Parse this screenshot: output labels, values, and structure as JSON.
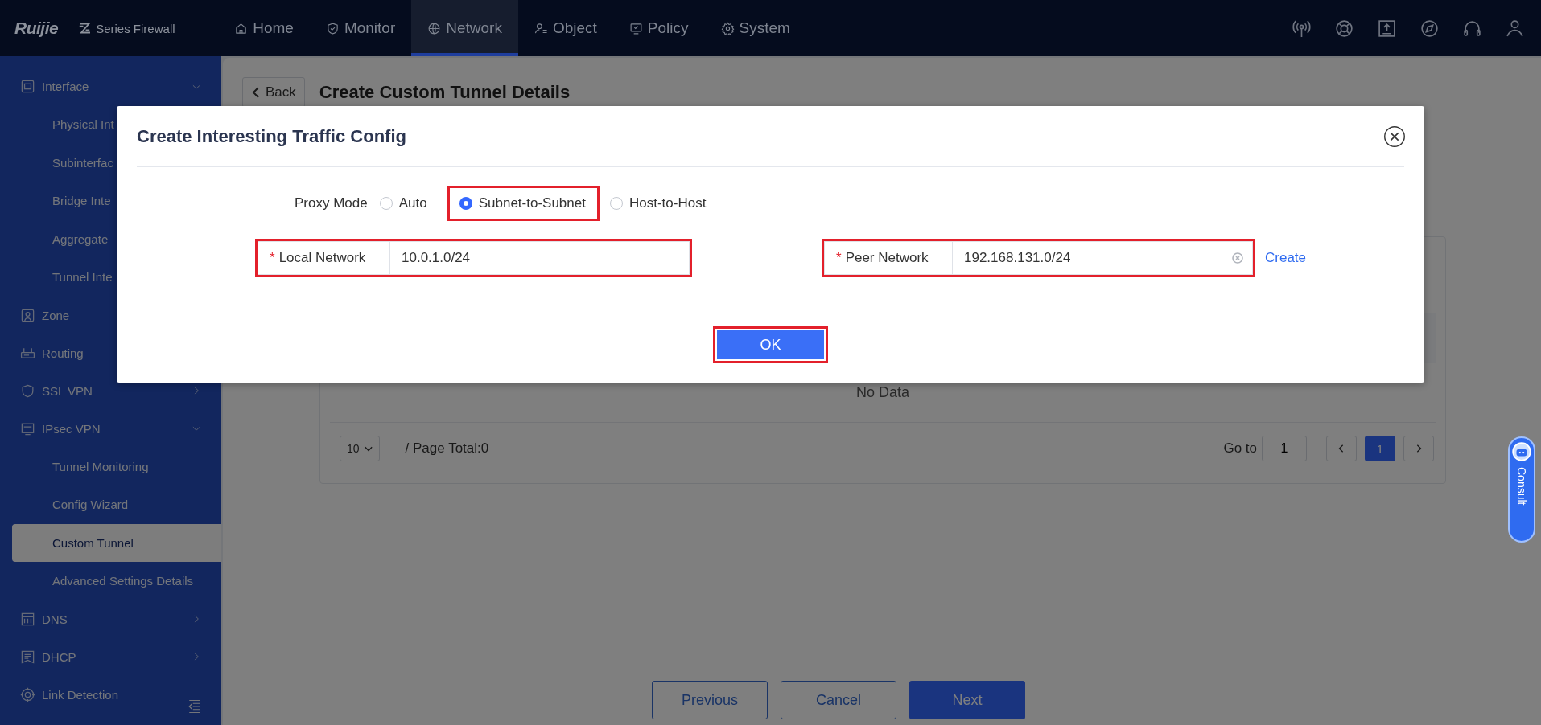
{
  "top_bar": {
    "logo": "Ruijie",
    "product": "Series Firewall",
    "nav": [
      {
        "label": "Home",
        "selected": false
      },
      {
        "label": "Monitor",
        "selected": false
      },
      {
        "label": "Network",
        "selected": true
      },
      {
        "label": "Object",
        "selected": false
      },
      {
        "label": "Policy",
        "selected": false
      },
      {
        "label": "System",
        "selected": false
      }
    ]
  },
  "sidebar": {
    "items": [
      {
        "label": "Interface",
        "expanded": true,
        "children": [
          {
            "label": "Physical Int",
            "selected": false
          },
          {
            "label": "Subinterfac",
            "selected": false
          },
          {
            "label": "Bridge Inte",
            "selected": false
          },
          {
            "label": "Aggregate",
            "selected": false
          },
          {
            "label": "Tunnel Inte",
            "selected": false
          }
        ]
      },
      {
        "label": "Zone"
      },
      {
        "label": "Routing"
      },
      {
        "label": "SSL VPN",
        "expanded": false
      },
      {
        "label": "IPsec VPN",
        "expanded": true,
        "children": [
          {
            "label": "Tunnel Monitoring",
            "selected": false
          },
          {
            "label": "Config Wizard",
            "selected": false
          },
          {
            "label": "Custom Tunnel",
            "selected": true
          },
          {
            "label": "Advanced Settings Details",
            "selected": false
          }
        ]
      },
      {
        "label": "DNS",
        "expanded": false
      },
      {
        "label": "DHCP",
        "expanded": false
      },
      {
        "label": "Link Detection"
      }
    ]
  },
  "page": {
    "back": "Back",
    "title": "Create Custom Tunnel Details",
    "table": {
      "empty": "No Data",
      "page_size": "10",
      "page_total": "/ Page Total:0",
      "goto_label": "Go to",
      "goto_value": "1",
      "pages": [
        {
          "label": "1",
          "selected": true
        }
      ]
    },
    "buttons": [
      {
        "label": "Previous",
        "kind": "outline"
      },
      {
        "label": "Cancel",
        "kind": "outline"
      },
      {
        "label": "Next",
        "kind": "primary"
      }
    ]
  },
  "consult": "Consult",
  "dialog": {
    "title": "Create Interesting Traffic Config",
    "proxy_mode": {
      "label": "Proxy Mode",
      "options": [
        {
          "label": "Auto",
          "selected": false
        },
        {
          "label": "Subnet-to-Subnet",
          "selected": true,
          "highlighted": true
        },
        {
          "label": "Host-to-Host",
          "selected": false
        }
      ]
    },
    "fields": [
      {
        "label": "Local Network",
        "required_mark": "*",
        "value": "10.0.1.0/24",
        "highlighted": true
      },
      {
        "label": "Peer Network",
        "required_mark": "*",
        "value": "192.168.131.0/24",
        "highlighted": true,
        "clearable": true,
        "link": "Create"
      }
    ],
    "ok": {
      "label": "OK",
      "highlighted": true
    }
  }
}
